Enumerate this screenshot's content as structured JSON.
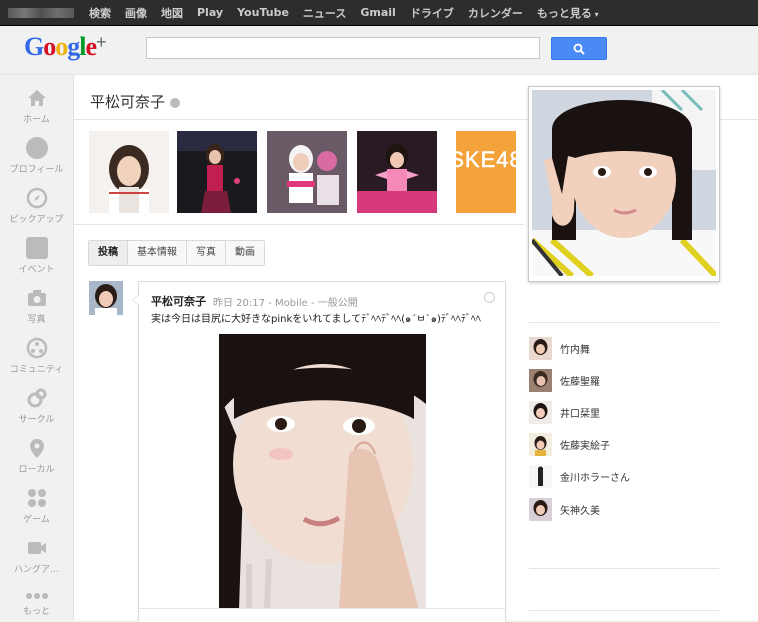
{
  "topbar": {
    "links": [
      "検索",
      "画像",
      "地図",
      "Play",
      "YouTube",
      "ニュース",
      "Gmail",
      "ドライブ",
      "カレンダー"
    ],
    "more": "もっと見る"
  },
  "logo": {
    "G": "G",
    "o1": "o",
    "o2": "o",
    "g": "g",
    "l": "l",
    "e": "e",
    "plus": "+"
  },
  "search": {
    "value": "",
    "button_icon": "search-icon"
  },
  "leftnav": [
    {
      "label": "ホーム",
      "icon": "home-icon"
    },
    {
      "label": "プロフィール",
      "icon": "profile-icon"
    },
    {
      "label": "ピックアップ",
      "icon": "compass-icon"
    },
    {
      "label": "イベント",
      "icon": "calendar-icon"
    },
    {
      "label": "写真",
      "icon": "camera-icon"
    },
    {
      "label": "コミュニティ",
      "icon": "community-icon"
    },
    {
      "label": "サークル",
      "icon": "circles-icon"
    },
    {
      "label": "ローカル",
      "icon": "location-pin-icon"
    },
    {
      "label": "ゲーム",
      "icon": "games-icon"
    },
    {
      "label": "ハングア…",
      "icon": "hangout-icon"
    },
    {
      "label": "もっと",
      "icon": "more-dots-icon"
    }
  ],
  "profile": {
    "name": "平松可奈子",
    "banner_logo": "SKE48"
  },
  "tabs": [
    "投稿",
    "基本情報",
    "写真",
    "動画"
  ],
  "post": {
    "author": "平松可奈子",
    "time": "昨日 20:17",
    "source": "Mobile",
    "visibility": "一般公開",
    "sep": "-",
    "text": "実は今日は目尻に大好きなpinkをいれてましてﾃﾞﾍﾍﾃﾞﾍﾍ(๑´ㅂ`๑)ﾃﾞﾍﾍﾃﾞﾍﾍ"
  },
  "circles": [
    "竹内舞",
    "佐藤聖羅",
    "井口栞里",
    "佐藤実絵子",
    "金川ホラーさん",
    "矢神久美"
  ],
  "colors": {
    "topbar": "#2d2d2d",
    "search_button": "#4a8af4",
    "ske_orange": "#f4a23a"
  }
}
